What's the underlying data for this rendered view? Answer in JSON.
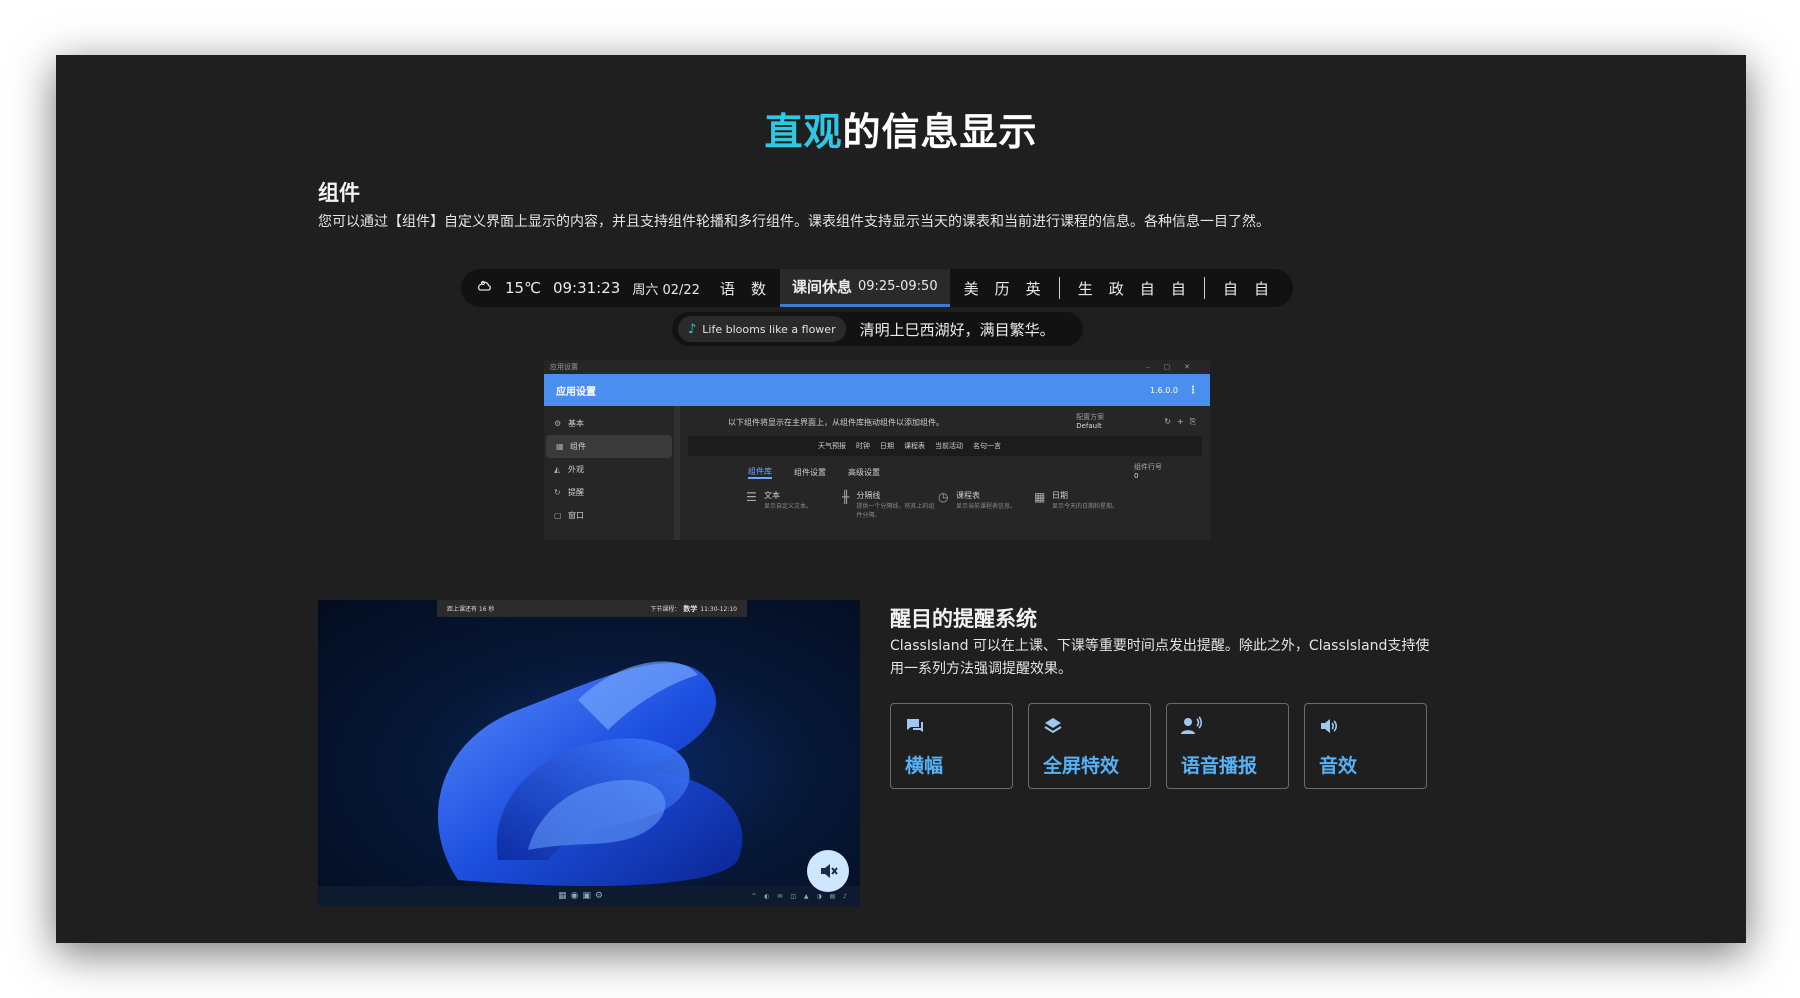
{
  "hero": {
    "accent": "直观",
    "rest": "的信息显示"
  },
  "components": {
    "heading": "组件",
    "desc": "您可以通过【组件】自定义界面上显示的内容，并且支持组件轮播和多行组件。课表组件支持显示当天的课表和当前进行课程的信息。各种信息一目了然。"
  },
  "status_bar": {
    "weather_icon": "weather-icon",
    "temperature": "15℃",
    "time": "09:31:23",
    "date": "周六 02/22",
    "subjects_before": [
      "语",
      "数"
    ],
    "current_label": "课间休息",
    "current_time": "09:25-09:50",
    "subjects_after_a": [
      "美",
      "历",
      "英"
    ],
    "subjects_after_b": [
      "生",
      "政",
      "自",
      "自"
    ],
    "subjects_after_c": [
      "自",
      "自"
    ]
  },
  "quote_bar": {
    "music_icon": "music-note-icon",
    "song": "Life blooms like a flower",
    "quote": "清明上巳西湖好，满目繁华。"
  },
  "settings_window": {
    "window_title": "应用设置",
    "app_title": "应用设置",
    "version": "1.6.0.0",
    "nav": [
      "基本",
      "组件",
      "外观",
      "提醒",
      "窗口"
    ],
    "hint": "以下组件将显示在主界面上，从组件库拖动组件以添加组件。",
    "preset_label": "配置方案",
    "preset_value": "Default",
    "quick_items": [
      "天气预报",
      "时钟",
      "日期",
      "课程表",
      "当前活动",
      "名句一言"
    ],
    "tabs": [
      "组件库",
      "组件设置",
      "高级设置"
    ],
    "field_label": "组件行号",
    "field_value": "0",
    "cards": [
      {
        "title": "文本",
        "sub": "显示自定义文本。"
      },
      {
        "title": "分隔线",
        "sub": "提供一个分隔线，将其上的组件分隔。"
      },
      {
        "title": "课程表",
        "sub": "显示当前课程表信息。"
      },
      {
        "title": "日期",
        "sub": "显示今天的日期和星期。"
      }
    ]
  },
  "desktop_preview": {
    "left_text": "距上课还有 16 秒",
    "next_label": "下节课程：",
    "next_subject": "数学",
    "next_time": "11:30-12:10",
    "mute_icon": "mute-speaker-icon"
  },
  "reminder": {
    "heading": "醒目的提醒系统",
    "desc": "ClassIsland 可以在上课、下课等重要时间点发出提醒。除此之外，ClassIsland支持使用一系列方法强调提醒效果。",
    "features": [
      {
        "icon": "chat-icon",
        "label": "横幅"
      },
      {
        "icon": "layers-icon",
        "label": "全屏特效"
      },
      {
        "icon": "voice-icon",
        "label": "语音播报"
      },
      {
        "icon": "speaker-icon",
        "label": "音效"
      }
    ]
  },
  "colors": {
    "accent": "#2ec8e6",
    "feature_label": "#58b0f5",
    "panel": "#1f1f1f"
  }
}
